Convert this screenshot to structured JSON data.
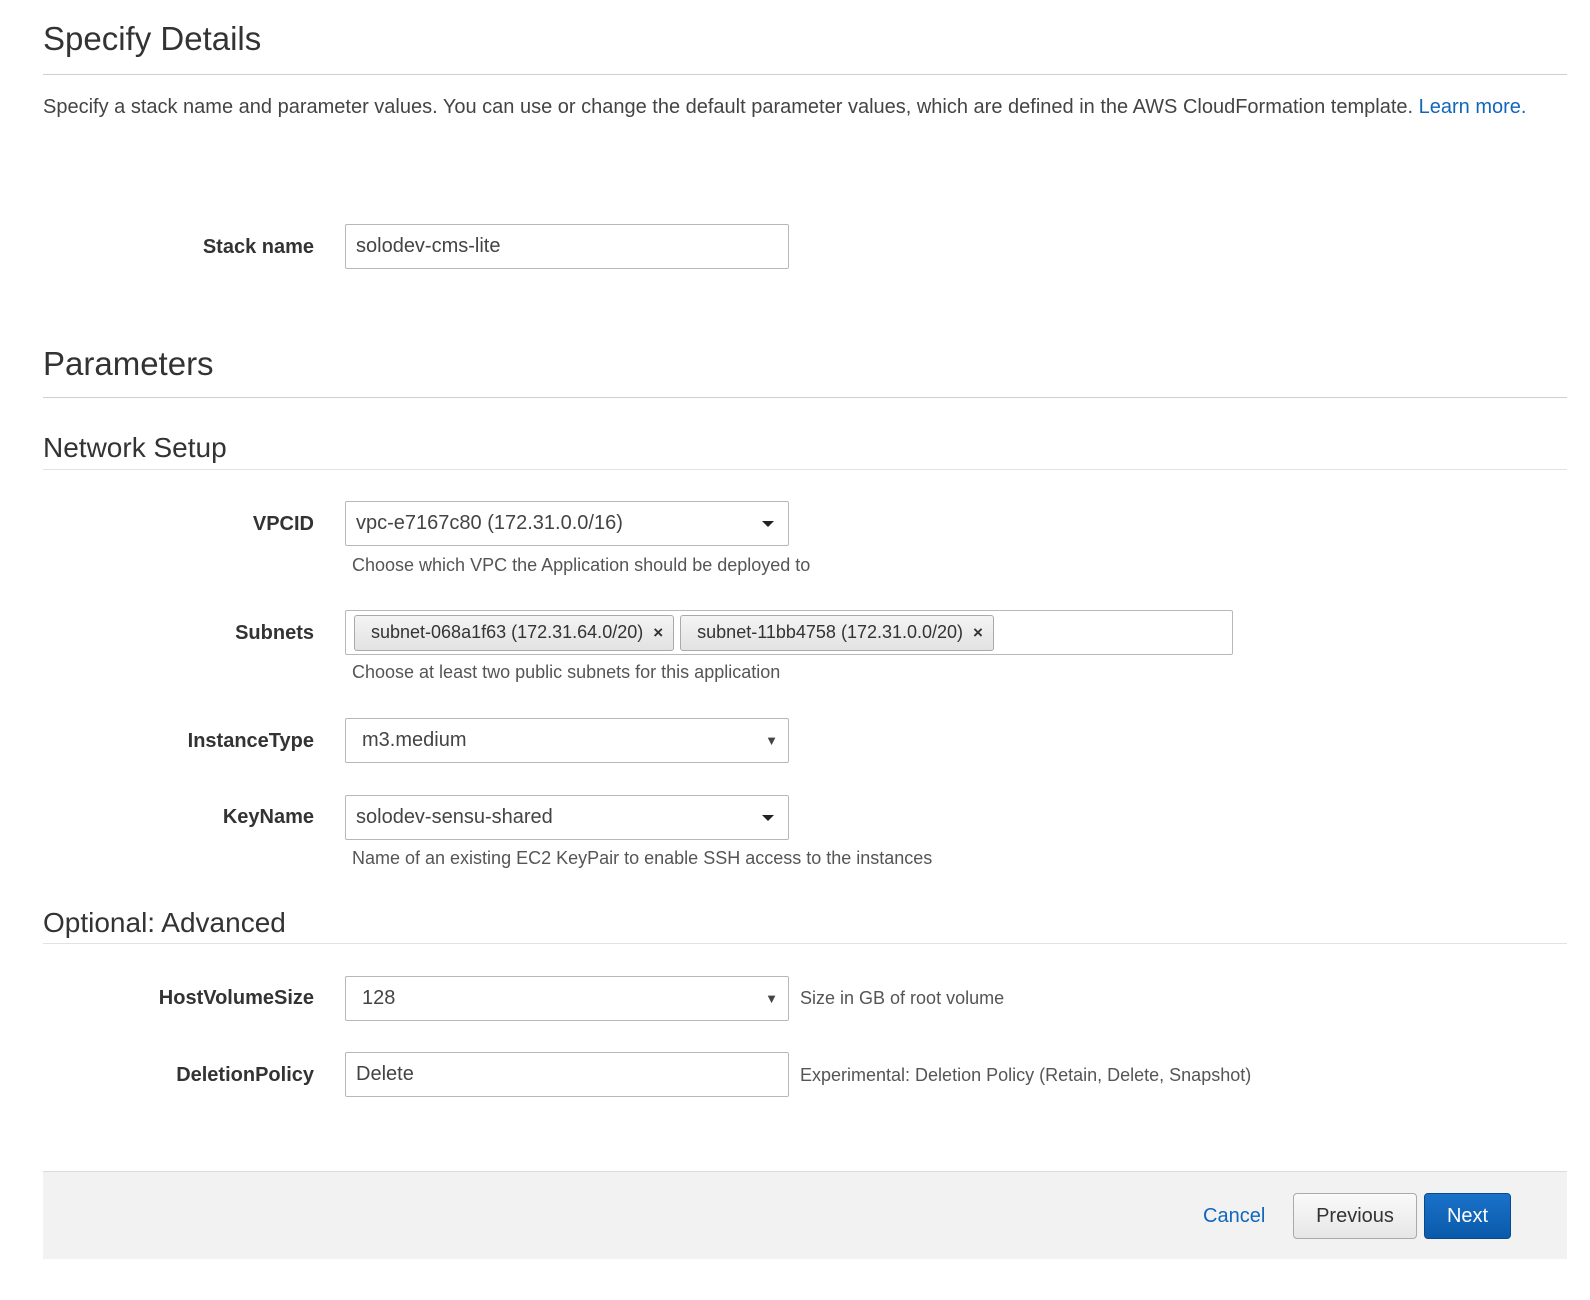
{
  "header": {
    "title": "Specify Details",
    "intro": "Specify a stack name and parameter values. You can use or change the default parameter values, which are defined in the AWS CloudFormation template. ",
    "learn_more": "Learn more."
  },
  "stack": {
    "label": "Stack name",
    "value": "solodev-cms-lite"
  },
  "parameters": {
    "title": "Parameters",
    "network": {
      "title": "Network Setup",
      "vpcid": {
        "label": "VPCID",
        "value": "vpc-e7167c80 (172.31.0.0/16)",
        "help": "Choose which VPC the Application should be deployed to"
      },
      "subnets": {
        "label": "Subnets",
        "chips": [
          "subnet-068a1f63 (172.31.64.0/20)",
          "subnet-11bb4758 (172.31.0.0/20)"
        ],
        "remove_glyph": "×",
        "help": "Choose at least two public subnets for this application"
      },
      "instance_type": {
        "label": "InstanceType",
        "value": "m3.medium"
      },
      "key_name": {
        "label": "KeyName",
        "value": "solodev-sensu-shared",
        "help": "Name of an existing EC2 KeyPair to enable SSH access to the instances"
      }
    },
    "advanced": {
      "title": "Optional: Advanced",
      "host_volume_size": {
        "label": "HostVolumeSize",
        "value": "128",
        "help": "Size in GB of root volume"
      },
      "deletion_policy": {
        "label": "DeletionPolicy",
        "value": "Delete",
        "help": "Experimental: Deletion Policy (Retain, Delete, Snapshot)"
      }
    }
  },
  "footer": {
    "cancel": "Cancel",
    "previous": "Previous",
    "next": "Next"
  },
  "colors": {
    "link": "#1166bb",
    "primary_button": "#0a5aaa"
  }
}
